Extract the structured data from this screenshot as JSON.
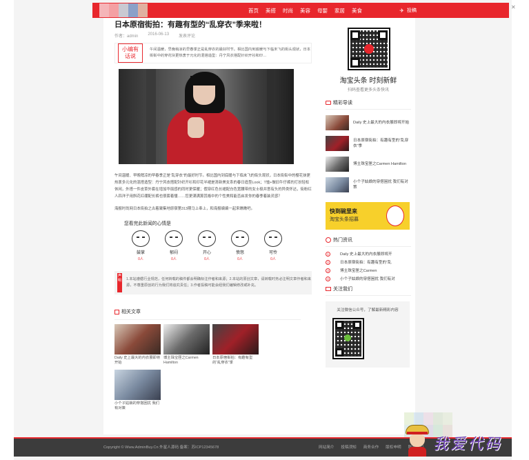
{
  "nav": {
    "items": [
      "首页",
      "美搭",
      "时尚",
      "美容",
      "母婴",
      "家居",
      "美食"
    ],
    "tougao": "投稿",
    "logo_colors": [
      "#f5b5b8",
      "#f4a0a3",
      "#c9c9d2",
      "#8aa0c8",
      "#e0b0a0"
    ]
  },
  "article": {
    "title": "日本原宿街拍：有趣有型的“乱穿衣”季来啦！",
    "meta_author": "作者：admin",
    "meta_date": "2016-06-13",
    "meta_comment": "发表评论",
    "intro_badge_line1": "小编有",
    "intro_badge_line2": "话说",
    "intro_text": "午间温暖，早晚稍凉的早春季正是乱穿衣的最好时节。相比国内到底暖与下临末飞的街头观状，日本街街中的穿花块更热衷于元化的混搭造型：丹宁风衣搭配针织开衫和印…",
    "body_p1": "午间温暖、早晚稍凉的早春季正是“乱穿衣”的最好时节。相比国内到底暖与下临末飞的街头观状，日本街街中的樱花抹更热衷多元化的混搭造型：丹宁风衣搭配针织开衫和印花半裙是清新美女系的春日造型Look；T恤+做旧牛仔裤的打扮轻松休闲，外搭一件皮草外套在增加华丽感的同时更保暖；假穿红色长裙配白色宽腰带的女士极并意有头的异类怀达，街粉红人四洋子用斜花红绷配长裤也很套着懂……您更满满算其格中的个性美和能否启发你的春季着装灵感？",
    "body_p2": "海报时尚网日本街拍之古着聚集地原宿第313期马上奉上，和海报编编一起来瞧瞧吧。",
    "mood_title": "您看完此新闻的心情是",
    "moods": [
      {
        "label": "鼓掌",
        "count": "0人"
      },
      {
        "label": "郁闷",
        "count": "0人"
      },
      {
        "label": "开心",
        "count": "0人"
      },
      {
        "label": "愤怒",
        "count": "0人"
      },
      {
        "label": "可怜",
        "count": "0人"
      }
    ],
    "notice_badge": "声明",
    "notice_text": "1.本站遵循行业规范，任何转载的稿件都会明确标注作者和来源；2.本站的原创文章，请转载时务必注明文章作者和来源，不尊重原创的行为我们将追究责任；3.作者投稿可能会经我们编辑修改或补充。",
    "related_title": "相关文章",
    "related": [
      {
        "caption": "Daily 史上最大的内衣展即将开始",
        "color": "#8a4a3a"
      },
      {
        "caption": "博主珠宝匣之Carmen Hamilton",
        "color": "#6a6a6a"
      },
      {
        "caption": "日本原宿街拍：有趣有型的“乱穿衣”季",
        "color": "#5a2024"
      },
      {
        "caption": "小个子姑娘的穿搭困扰 我们有对策",
        "color": "#7a8aa0"
      }
    ]
  },
  "sidebar": {
    "brand": "淘宝头条 时刻新鲜",
    "brand_sub": "扫码查看更多头条快讯",
    "picks_title": "精彩导读",
    "picks": [
      {
        "text": "Daily 史上最大的内衣展即将开始",
        "color": "#8a4a3a"
      },
      {
        "text": "日本原宿街拍：有趣有型的“乱穿衣”季",
        "color": "#5a2024"
      },
      {
        "text": "博主珠宝匣之Carmen Hamilton",
        "color": "#6a6a6a"
      },
      {
        "text": "小个子姑娘的穿搭困扰 我们有对策",
        "color": "#7a8aa0"
      }
    ],
    "ad_line1": "快到碗里来",
    "ad_line2": "淘宝头条招募",
    "hot_title": "热门资讯",
    "hot": [
      {
        "num": "1",
        "text": "Daily 史上最大的内衣展即将开"
      },
      {
        "num": "2",
        "text": "日本原宿街拍：有趣有型的“乱"
      },
      {
        "num": "3",
        "text": "博主珠宝匣之Carmen"
      },
      {
        "num": "4",
        "text": "小个子姑娘的穿搭困扰 我们有对"
      }
    ],
    "follow_title": "关注我们",
    "follow_text": "关注微信公众号，了解最新精彩内容"
  },
  "footer": {
    "copyright": "Copyright © Www.AdminBuy.Cn 外星人源码 备案：苏ICP12345678",
    "links": [
      "网站简介",
      "投稿须知",
      "商务合作",
      "版权申明",
      "联系我们"
    ]
  },
  "watermark": {
    "text": "我爱代码"
  }
}
